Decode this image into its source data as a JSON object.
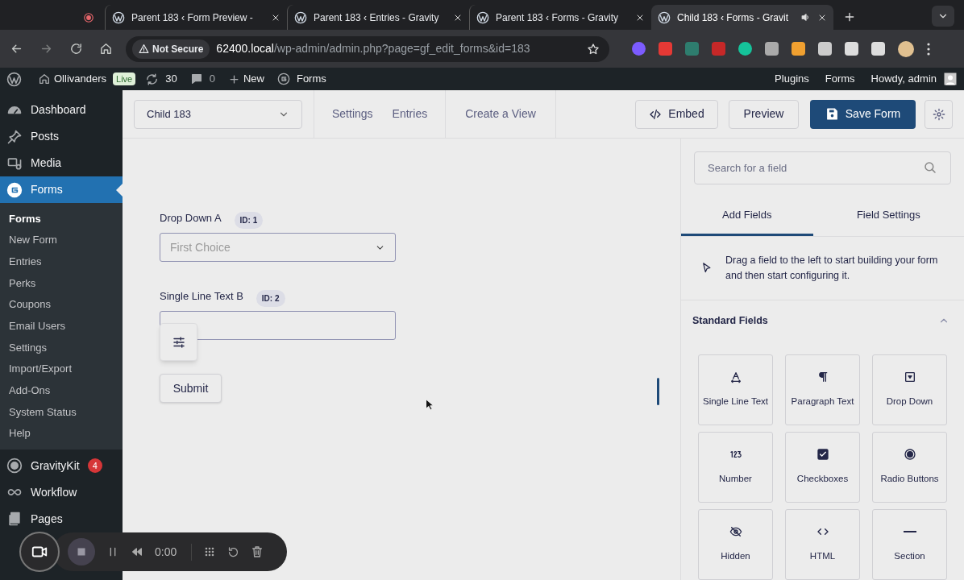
{
  "browser": {
    "tabs": [
      {
        "kind": "pinned",
        "selected": false
      },
      {
        "kind": "page",
        "title": "Parent 183 ‹ Form Preview -",
        "selected": false
      },
      {
        "kind": "page",
        "title": "Parent 183 ‹ Entries - Gravity",
        "selected": false
      },
      {
        "kind": "page",
        "title": "Parent 183 ‹ Forms - Gravity",
        "selected": false
      },
      {
        "kind": "page",
        "title": "Child 183 ‹ Forms - Gravit",
        "selected": true,
        "audio": true
      }
    ],
    "address": {
      "security": "Not Secure",
      "host": "62400.local",
      "path": "/wp-admin/admin.php?page=gf_edit_forms&id=183"
    }
  },
  "admin_bar": {
    "site": "Ollivanders",
    "badge": "Live",
    "updates": "30",
    "comments": "0",
    "new": "New",
    "forms": "Forms",
    "right_links": [
      "Plugins",
      "Forms"
    ],
    "greeting": "Howdy, admin"
  },
  "sidebar": {
    "items": [
      {
        "kind": "dashboard",
        "label": "Dashboard",
        "selected": false
      },
      {
        "kind": "posts",
        "label": "Posts",
        "selected": false
      },
      {
        "kind": "media",
        "label": "Media",
        "selected": false
      },
      {
        "kind": "forms",
        "label": "Forms",
        "selected": true,
        "children": [
          {
            "label": "Forms",
            "selected": true
          },
          {
            "label": "New Form",
            "selected": false
          },
          {
            "label": "Entries",
            "selected": false
          },
          {
            "label": "Perks",
            "selected": false
          },
          {
            "label": "Coupons",
            "selected": false
          },
          {
            "label": "Email Users",
            "selected": false
          },
          {
            "label": "Settings",
            "selected": false
          },
          {
            "label": "Import/Export",
            "selected": false
          },
          {
            "label": "Add-Ons",
            "selected": false
          },
          {
            "label": "System Status",
            "selected": false
          },
          {
            "label": "Help",
            "selected": false
          }
        ]
      },
      {
        "kind": "gravitykit",
        "label": "GravityKit",
        "selected": false,
        "badge": "4"
      },
      {
        "kind": "workflow",
        "label": "Workflow",
        "selected": false
      },
      {
        "kind": "pages",
        "label": "Pages",
        "selected": false
      }
    ]
  },
  "toolbar": {
    "form_select": "Child 183",
    "links": [
      "Settings",
      "Entries"
    ],
    "view_link": "Create a View",
    "embed": "Embed",
    "preview": "Preview",
    "save": "Save Form"
  },
  "form": {
    "fields": [
      {
        "kind": "select",
        "label": "Drop Down A",
        "id_badge": "ID: 1",
        "placeholder": "First Choice"
      },
      {
        "kind": "text",
        "label": "Single Line Text B",
        "id_badge": "ID: 2"
      }
    ],
    "submit": "Submit"
  },
  "panel": {
    "search_placeholder": "Search for a field",
    "tabs": [
      {
        "label": "Add Fields",
        "selected": true
      },
      {
        "label": "Field Settings",
        "selected": false
      }
    ],
    "hint": "Drag a field to the left to start building your form and then start configuring it.",
    "section": {
      "title": "Standard Fields",
      "expanded": true
    },
    "fields": [
      {
        "kind": "text",
        "label": "Single Line Text"
      },
      {
        "kind": "paragraph",
        "label": "Paragraph Text"
      },
      {
        "kind": "select",
        "label": "Drop Down"
      },
      {
        "kind": "number",
        "label": "Number"
      },
      {
        "kind": "checkbox",
        "label": "Checkboxes"
      },
      {
        "kind": "radio",
        "label": "Radio Buttons"
      },
      {
        "kind": "hidden",
        "label": "Hidden"
      },
      {
        "kind": "html",
        "label": "HTML"
      },
      {
        "kind": "section",
        "label": "Section"
      }
    ]
  },
  "recorder": {
    "time": "0:00"
  }
}
